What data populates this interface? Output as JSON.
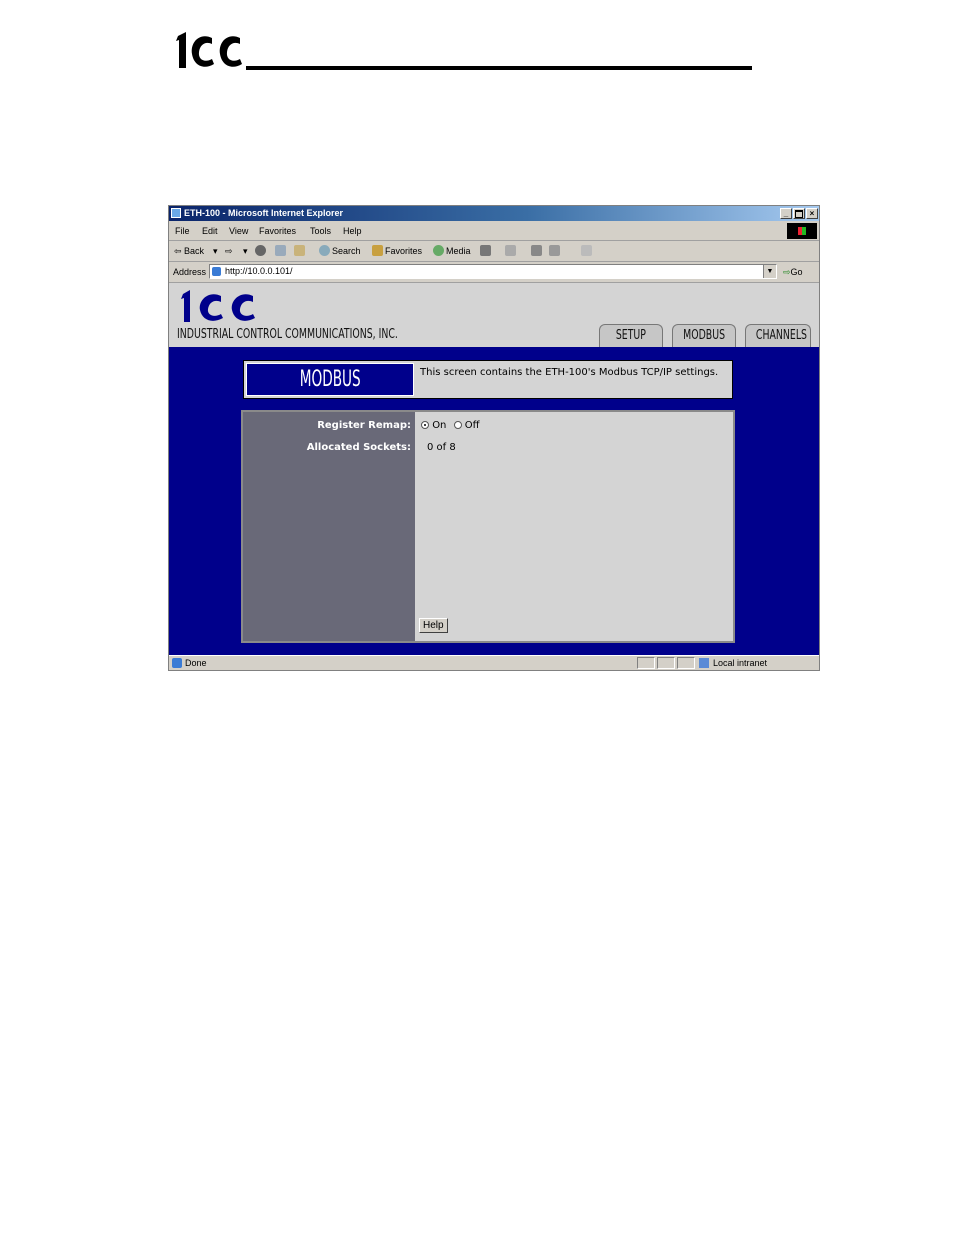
{
  "browser": {
    "title": "ETH-100 - Microsoft Internet Explorer",
    "window_controls": [
      "_",
      " ",
      "×"
    ],
    "menu": [
      "File",
      "Edit",
      "View",
      "Favorites",
      "Tools",
      "Help"
    ],
    "toolbar": {
      "back": "⇦ Back",
      "search": "Search",
      "favorites": "Favorites",
      "media": "Media"
    },
    "address": {
      "label": "Address",
      "url": "http://10.0.0.101/",
      "go": "Go"
    },
    "status": {
      "text": "Done",
      "zone": "Local intranet"
    }
  },
  "page": {
    "company": "INDUSTRIAL CONTROL COMMUNICATIONS, INC.",
    "tabs": [
      "SETUP",
      "MODBUS",
      "CHANNELS"
    ],
    "section_title": "MODBUS",
    "description": "This screen contains the ETH-100's Modbus TCP/IP settings.",
    "settings": {
      "register_remap_label": "Register Remap:",
      "register_remap_options": [
        "On",
        "Off"
      ],
      "register_remap_selected": "On",
      "allocated_sockets_label": "Allocated Sockets:",
      "allocated_sockets_value": "0 of 8"
    },
    "help_button": "Help"
  },
  "colors": {
    "page_background": "#00008b",
    "panel_gray": "#d4d4d4",
    "label_column": "#696978"
  }
}
